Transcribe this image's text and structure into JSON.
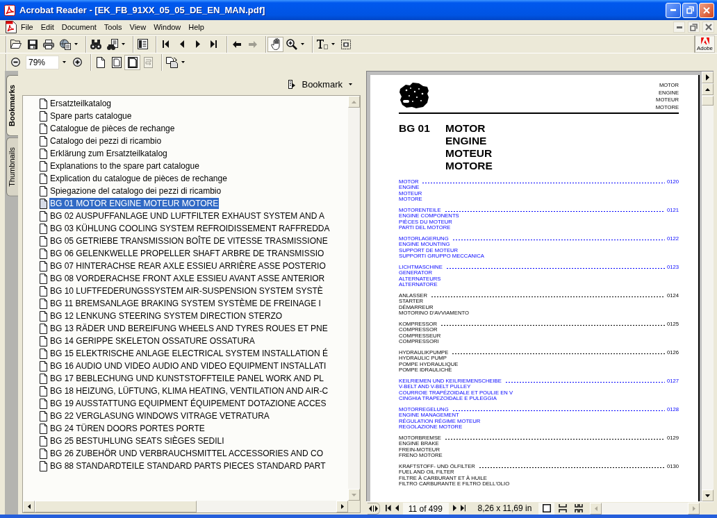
{
  "window": {
    "title": "Acrobat Reader - [EK_FB_91XX_05_05_DE_EN_MAN.pdf]"
  },
  "menu_bar": {
    "items": [
      "File",
      "Edit",
      "Document",
      "Tools",
      "View",
      "Window",
      "Help"
    ]
  },
  "toolbar_rows": [
    [
      [
        {
          "kind": "button",
          "selected": false,
          "disabled": false
        },
        {
          "kind": "button",
          "selected": false,
          "disabled": false
        },
        {
          "kind": "button",
          "selected": false,
          "disabled": false
        },
        {
          "kind": "menu_button",
          "selected": false,
          "disabled": false
        }
      ],
      [
        {
          "kind": "button",
          "selected": false,
          "disabled": false
        },
        {
          "kind": "menu_button",
          "selected": false,
          "disabled": false
        }
      ],
      [
        {
          "kind": "button",
          "selected": false,
          "disabled": false
        }
      ],
      [
        {
          "kind": "button",
          "selected": false,
          "disabled": false
        },
        {
          "kind": "button",
          "selected": false,
          "disabled": false
        },
        {
          "kind": "button",
          "selected": false,
          "disabled": false
        },
        {
          "kind": "button",
          "selected": false,
          "disabled": false
        }
      ],
      [
        {
          "kind": "button",
          "selected": false,
          "disabled": false
        },
        {
          "kind": "button",
          "selected": false,
          "disabled": true
        }
      ],
      [
        {
          "kind": "button",
          "selected": true,
          "disabled": false
        },
        {
          "kind": "menu_button",
          "selected": false,
          "disabled": false
        }
      ],
      [
        {
          "kind": "menu_button",
          "selected": false,
          "disabled": false
        },
        {
          "kind": "button",
          "selected": false,
          "disabled": false
        }
      ]
    ],
    [
      [
        {
          "kind": "button",
          "selected": false,
          "disabled": false
        },
        {
          "kind": "field",
          "value": "79%"
        },
        {
          "kind": "button",
          "selected": false,
          "disabled": false
        }
      ],
      [
        {
          "kind": "button",
          "selected": false,
          "disabled": false
        },
        {
          "kind": "button",
          "selected": false,
          "disabled": false
        },
        {
          "kind": "button",
          "selected": true,
          "disabled": false
        },
        {
          "kind": "button",
          "selected": false,
          "disabled": true
        }
      ],
      [
        {
          "kind": "menu_button",
          "selected": false,
          "disabled": false
        }
      ]
    ]
  ],
  "logo": {
    "text": "Adobe"
  },
  "navigation_panel": {
    "tabs": [
      {
        "label": "Bookmarks",
        "selected": true
      },
      {
        "label": "Thumbnails",
        "selected": false
      }
    ],
    "options_label": "Bookmark",
    "items": [
      {
        "label": "Ersatzteilkatalog",
        "selected": false
      },
      {
        "label": "Spare parts catalogue",
        "selected": false
      },
      {
        "label": "Catalogue de pièces de rechange",
        "selected": false
      },
      {
        "label": "Catalogo dei pezzi di ricambio",
        "selected": false
      },
      {
        "label": "Erklärung zum Ersatzteilkatalog",
        "selected": false
      },
      {
        "label": "Explanations to the spare part catalogue",
        "selected": false
      },
      {
        "label": "Explication du catalogue de pièces de rechange",
        "selected": false
      },
      {
        "label": "Spiegazione del catalogo dei pezzi di ricambio",
        "selected": false
      },
      {
        "label": "BG 01 MOTOR ENGINE MOTEUR MOTORE",
        "selected": true
      },
      {
        "label": "BG 02 AUSPUFFANLAGE UND LUFTFILTER EXHAUST SYSTEM AND A",
        "selected": false
      },
      {
        "label": "BG 03 KÜHLUNG COOLING SYSTEM REFROIDISSEMENT RAFFREDDA",
        "selected": false
      },
      {
        "label": "BG 05 GETRIEBE TRANSMISSION BOÎTE DE VITESSE TRASMISSIONE",
        "selected": false
      },
      {
        "label": "BG 06 GELENKWELLE PROPELLER SHAFT ARBRE DE TRANSMISSIO",
        "selected": false
      },
      {
        "label": "BG 07 HINTERACHSE REAR AXLE ESSIEU ARRIÈRE ASSE POSTERIO",
        "selected": false
      },
      {
        "label": "BG 08 VORDERACHSE FRONT AXLE ESSIEU AVANT ASSE ANTERIOR",
        "selected": false
      },
      {
        "label": "BG 10 LUFTFEDERUNGSSYSTEM AIR-SUSPENSION SYSTEM SYSTÈ",
        "selected": false
      },
      {
        "label": "BG 11 BREMSANLAGE BRAKING SYSTEM SYSTÈME DE FREINAGE I",
        "selected": false
      },
      {
        "label": "BG 12 LENKUNG STEERING SYSTEM DIRECTION STERZO",
        "selected": false
      },
      {
        "label": "BG 13 RÄDER UND BEREIFUNG WHEELS AND TYRES ROUES ET PNE",
        "selected": false
      },
      {
        "label": "BG 14 GERIPPE SKELETON OSSATURE OSSATURA",
        "selected": false
      },
      {
        "label": "BG 15 ELEKTRISCHE ANLAGE ELECTRICAL SYSTEM INSTALLATION É",
        "selected": false
      },
      {
        "label": "BG 16 AUDIO UND VIDEO AUDIO AND VIDEO EQUIPMENT INSTALLATI",
        "selected": false
      },
      {
        "label": "BG 17 BEBLECHUNG UND KUNSTSTOFFTEILE PANEL WORK AND PL",
        "selected": false
      },
      {
        "label": "BG 18 HEIZUNG, LÜFTUNG, KLIMA HEATING, VENTILATION AND AIR-C",
        "selected": false
      },
      {
        "label": "BG 19 AUSSTATTUNG EQUIPMENT ÉQUIPEMENT DOTAZIONE ACCES",
        "selected": false
      },
      {
        "label": "BG 22 VERGLASUNG WINDOWS VITRAGE VETRATURA",
        "selected": false
      },
      {
        "label": "BG 24 TÜREN DOORS PORTES PORTE",
        "selected": false
      },
      {
        "label": "BG 25 BESTUHLUNG SEATS SIÈGES SEDILI",
        "selected": false
      },
      {
        "label": "BG 26 ZUBEHÖR UND VERBRAUCHSMITTEL ACCESSORIES AND CO",
        "selected": false
      },
      {
        "label": "BG 88 STANDARDTEILE STANDARD PARTS PIECES STANDARD PART",
        "selected": false
      }
    ]
  },
  "document": {
    "header": [
      "MOTOR",
      "ENGINE",
      "MOTEUR",
      "MOTORE"
    ],
    "group": "BG 01",
    "titles": [
      "MOTOR",
      "ENGINE",
      "MOTEUR",
      "MOTORE"
    ],
    "contents": [
      {
        "lines": [
          "MOTOR",
          "ENGINE",
          "MOTEUR",
          "MOTORE"
        ],
        "page": "0120",
        "color": "#0000ff"
      },
      {
        "lines": [
          "MOTORENTEILE",
          "ENGINE COMPONENTS",
          "PIÈCES DU MOTEUR",
          "PARTI DEL MOTORE"
        ],
        "page": "0121",
        "color": "#0000ff"
      },
      {
        "lines": [
          "MOTORLAGERUNG",
          "ENGINE MOUNTING",
          "SUPPORT DE MOTEUR",
          "SUPPORTI GRUPPO MECCANICA"
        ],
        "page": "0122",
        "color": "#0000ff"
      },
      {
        "lines": [
          "LICHTMASCHINE",
          "GENERATOR",
          "ALTERNATEURS",
          "ALTERNATORE"
        ],
        "page": "0123",
        "color": "#0000ff"
      },
      {
        "lines": [
          "ANLASSER",
          "STARTER",
          "DÉMARREUR",
          "MOTORINO D'AVVIAMENTO"
        ],
        "page": "0124",
        "color": "#000000"
      },
      {
        "lines": [
          "KOMPRESSOR",
          "COMPRESSOR",
          "COMPRESSEUR",
          "COMPRESSORI"
        ],
        "page": "0125",
        "color": "#000000"
      },
      {
        "lines": [
          "HYDRAULIKPUMPE",
          "HYDRAULIC PUMP",
          "POMPE HYDRAULIQUE",
          "POMPE IDRAULICHE"
        ],
        "page": "0126",
        "color": "#000000"
      },
      {
        "lines": [
          "KEILRIEMEN UND KEILRIEMENSCHEIBE",
          "V-BELT AND V-BELT PULLEY",
          "COURROIE TRAPÉZOIDALE ET POULIE EN V",
          "CINGHIA TRAPEZOIDALE E PULEGGIA"
        ],
        "page": "0127",
        "color": "#0000ff"
      },
      {
        "lines": [
          "MOTORREGELUNG",
          "ENGINE MANAGEMENT",
          "RÉGULATION RÉGIME MOTEUR",
          "REGOLAZIONE MOTORE"
        ],
        "page": "0128",
        "color": "#0000ff"
      },
      {
        "lines": [
          "MOTORBREMSE",
          "ENGINE BRAKE",
          "FREIN-MOTEUR",
          "FRENO MOTORE"
        ],
        "page": "0129",
        "color": "#000000"
      },
      {
        "lines": [
          "KRAFTSTOFF- UND ÖLFILTER",
          "FUEL AND OIL FILTER",
          "FILTRE À CARBURANT ET À HUILE",
          "FILTRO CARBURANTE E FILTRO DELL'OLIO"
        ],
        "page": "0130",
        "color": "#000000"
      }
    ]
  },
  "status_bar": {
    "page_field": "11 of 499",
    "page_size": "8,26 x 11,69 in",
    "view_modes": [
      {
        "selected": true
      },
      {
        "selected": false
      },
      {
        "selected": false
      }
    ]
  }
}
